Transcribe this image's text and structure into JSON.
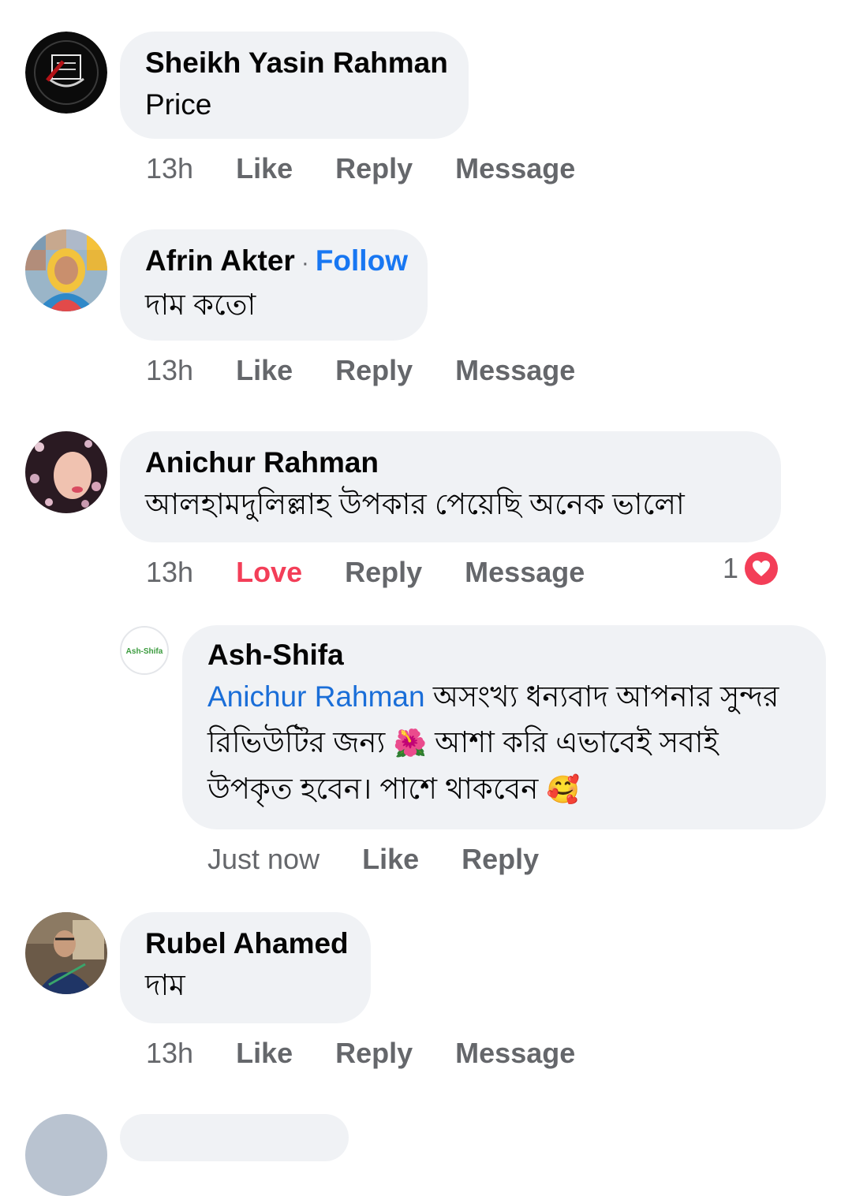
{
  "comments": [
    {
      "name": "Sheikh Yasin Rahman",
      "text": "Price",
      "time": "13h",
      "like": "Like",
      "reply": "Reply",
      "message": "Message"
    },
    {
      "name": "Afrin Akter",
      "follow_separator": "·",
      "follow": "Follow",
      "text": "দাম কতো",
      "time": "13h",
      "like": "Like",
      "reply": "Reply",
      "message": "Message"
    },
    {
      "name": "Anichur Rahman",
      "text": "আলহামদুলিল্লাহ উপকার পেয়েছি অনেক ভালো",
      "time": "13h",
      "like": "Love",
      "reply": "Reply",
      "message": "Message",
      "reaction_count": "1",
      "reaction_icon": "heart-icon",
      "reaction_color": "#f33e58"
    },
    {
      "name": "Rubel Ahamed",
      "text": "দাম",
      "time": "13h",
      "like": "Like",
      "reply": "Reply",
      "message": "Message"
    }
  ],
  "reply": {
    "page_name": "Ash-Shifa",
    "avatar_text": "Ash-Shifa",
    "mention": "Anichur Rahman",
    "text_part1": " অসংখ্য ধন্যবাদ আপনার সুন্দর রিভিউটির জন্য ",
    "emoji1": "🌺",
    "text_part2": " আশা করি এভাবেই সবাই উপকৃত হবেন। পাশে থাকবেন ",
    "emoji2": "🥰",
    "time": "Just now",
    "like": "Like",
    "reply": "Reply"
  },
  "colors": {
    "bubble": "#f0f2f5",
    "link": "#1877f2",
    "meta": "#65676b",
    "love": "#f33e58"
  }
}
